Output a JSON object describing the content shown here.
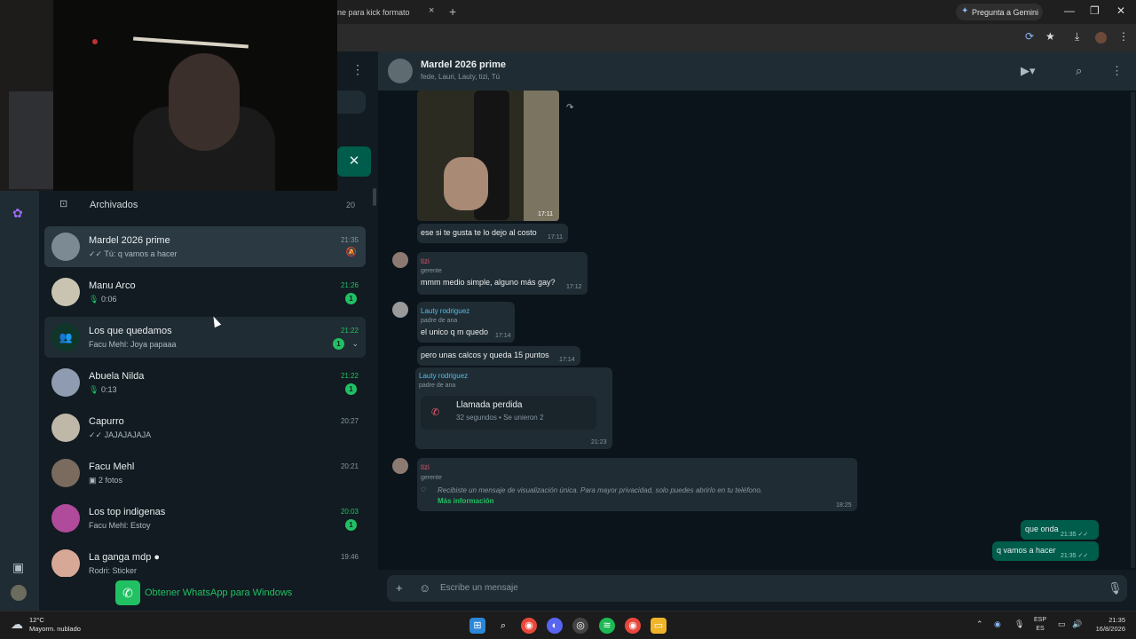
{
  "browser": {
    "tab_title": "ne para kick formato",
    "tab_close": "×",
    "new_tab": "+",
    "gemini_label": "Pregunta a Gemini",
    "window_minimize": "—",
    "window_restore": "❐",
    "window_close": "✕"
  },
  "sidebar": {
    "archived_label": "Archivados",
    "archived_count": "20",
    "close_icon": "✕"
  },
  "chats": [
    {
      "name": "Mardel 2026 prime",
      "preview": "✓✓ Tú: q vamos a hacer",
      "time": "21:35",
      "unread": "",
      "muted": true
    },
    {
      "name": "Manu Arco",
      "preview": "0:06",
      "time": "21:26",
      "unread": "1",
      "voice": true
    },
    {
      "name": "Los que quedamos",
      "preview": "Facu Mehl: Joya papaaa",
      "time": "21:22",
      "unread": "1"
    },
    {
      "name": "Abuela Nilda",
      "preview": "0:13",
      "time": "21:22",
      "unread": "1",
      "voice": true
    },
    {
      "name": "Capurro",
      "preview": "✓✓ JAJAJAJAJA",
      "time": "20:27",
      "unread": ""
    },
    {
      "name": "Facu Mehl",
      "preview": "2 fotos",
      "time": "20:21",
      "unread": ""
    },
    {
      "name": "Los top indigenas",
      "preview": "Facu Mehl: Estoy",
      "time": "20:03",
      "unread": "1"
    },
    {
      "name": "La ganga mdp",
      "preview": "Rodri: Sticker",
      "time": "19:46",
      "unread": ""
    }
  ],
  "get_whatsapp": "Obtener WhatsApp para Windows",
  "chat": {
    "title": "Mardel 2026 prime",
    "participants": "fede, Lauri, Lauty, tizi, Tú",
    "messages": {
      "photo_time": "17:11",
      "m1_text": "ese si te gusta te lo dejo al costo",
      "m1_time": "17:11",
      "m2_sender": "tizi",
      "m2_role": "gerente",
      "m2_text": "mmm medio simple, alguno más gay?",
      "m2_time": "17:12",
      "m3_sender": "Lauty rodriguez",
      "m3_role": "padre de ana",
      "m3_text": "el unico q m quedo",
      "m3_time": "17:14",
      "m4_text": "pero unas calcos y queda 15 puntos",
      "m4_time": "17:14",
      "m5_sender": "Lauty rodriguez",
      "m5_role": "padre de ana",
      "m5_call_title": "Llamada perdida",
      "m5_call_sub": "32 segundos • Se unieron 2",
      "m5_time": "21:23",
      "m6_sender": "tizi",
      "m6_role": "gerente",
      "m6_text": "Recibiste un mensaje de visualización única. Para mayor privacidad, solo puedes abrirlo en tu teléfono.",
      "m6_link": "Más información",
      "m6_time": "18:25",
      "out1_text": "que onda",
      "out1_time": "21:35 ✓✓",
      "out2_text": "q vamos a hacer",
      "out2_time": "21:35 ✓✓"
    },
    "composer_placeholder": "Escribe un mensaje"
  },
  "taskbar": {
    "temp": "12°C",
    "weather": "Mayorm. nublado",
    "lang1": "ESP",
    "lang2": "ES",
    "time": "21:35",
    "date": "16/8/2026"
  },
  "colors": {
    "accent": "#21c063",
    "outgoing_bubble": "#005c4b",
    "incoming_bubble": "#202c33",
    "sender_tizi": "#e0526b",
    "sender_lauty": "#53bdeb"
  }
}
